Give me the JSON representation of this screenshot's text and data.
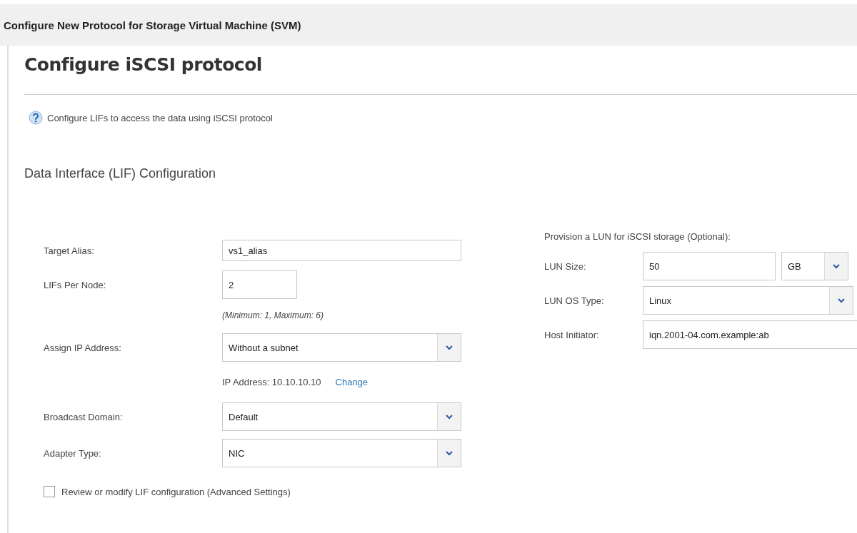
{
  "window": {
    "title": "Configure New Protocol for Storage Virtual Machine (SVM)"
  },
  "page": {
    "heading": "Configure iSCSI protocol",
    "help_text": "Configure LIFs to access the data using iSCSI protocol",
    "section": "Data Interface (LIF) Configuration"
  },
  "lif_form": [
    {
      "kind": "text",
      "label": "Target Alias:",
      "value": "vs1_alias"
    },
    {
      "kind": "short",
      "label": "LIFs Per Node:",
      "value": "2"
    },
    {
      "kind": "hint",
      "text": "(Minimum: 1, Maximum: 6)"
    },
    {
      "kind": "select",
      "label": "Assign IP Address:",
      "value": "Without a subnet"
    },
    {
      "kind": "info",
      "text": "IP Address: 10.10.10.10",
      "link": "Change"
    },
    {
      "kind": "select",
      "label": "Broadcast Domain:",
      "value": "Default"
    },
    {
      "kind": "select",
      "label": "Adapter Type:",
      "value": "NIC"
    }
  ],
  "advanced": {
    "label": "Review or modify LIF configuration (Advanced Settings)",
    "checked": false
  },
  "lun": {
    "title": "Provision a LUN for iSCSI storage (Optional):",
    "rows": [
      {
        "kind": "size",
        "label": "LUN Size:",
        "value": "50",
        "unit": "GB"
      },
      {
        "kind": "select",
        "label": "LUN OS Type:",
        "value": "Linux"
      },
      {
        "kind": "text",
        "label": "Host Initiator:",
        "value": "iqn.2001-04.com.example:ab"
      }
    ]
  }
}
